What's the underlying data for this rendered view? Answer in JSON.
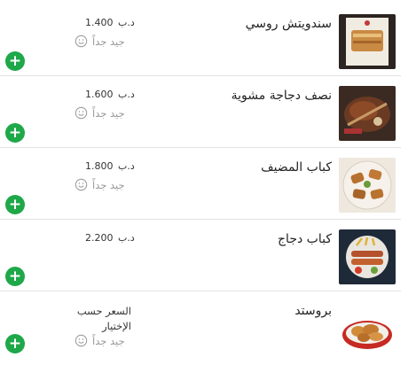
{
  "menu": {
    "items": [
      {
        "name": "سندويتش روسي",
        "price": "1.400",
        "currency": "د.ب",
        "rating": "جيد جداً",
        "add_label": "+",
        "thumb": "sandwich-photo"
      },
      {
        "name": "نصف دجاجة مشوية",
        "price": "1.600",
        "currency": "د.ب",
        "rating": "جيد جداً",
        "add_label": "+",
        "thumb": "grilled-chicken-photo"
      },
      {
        "name": "كباب المضيف",
        "price": "1.800",
        "currency": "د.ب",
        "rating": "جيد جداً",
        "add_label": "+",
        "thumb": "kebab-photo"
      },
      {
        "name": "كباب دجاج",
        "price": "2.200",
        "currency": "د.ب",
        "add_label": "+",
        "thumb": "chicken-kebab-photo"
      },
      {
        "name": "بروستد",
        "price_text": "السعر حسب الإختيار",
        "rating": "جيد جداً",
        "add_label": "+",
        "thumb": "broasted-photo"
      }
    ]
  },
  "colors": {
    "add_button": "#1fa84a",
    "divider": "#e2e2e2",
    "rating_text": "#999999"
  },
  "icons": {
    "rating": "smiley-icon",
    "add": "plus-icon"
  }
}
